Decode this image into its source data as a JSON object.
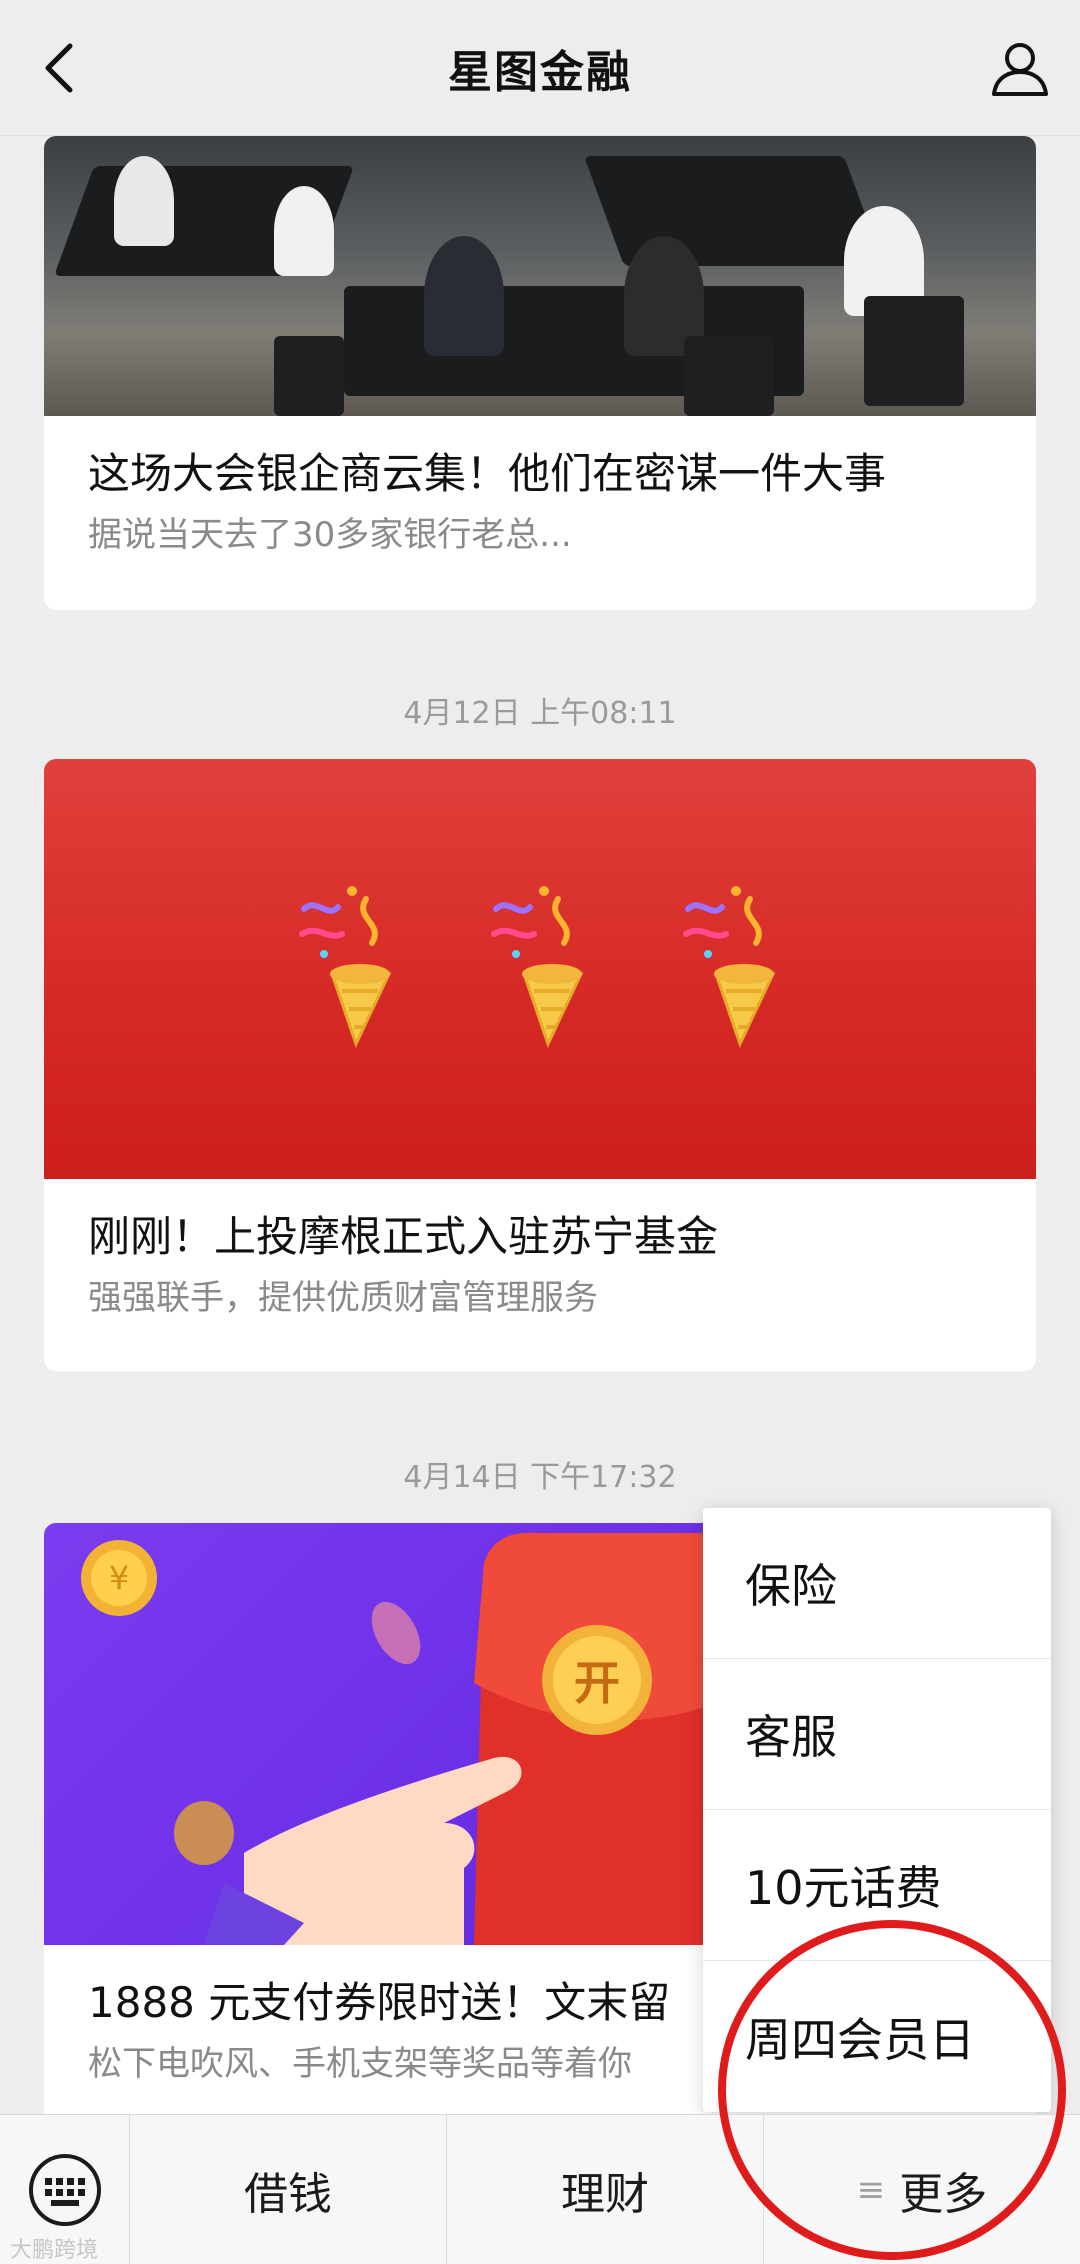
{
  "header": {
    "title": "星图金融",
    "back_icon": "chevron-left-icon",
    "user_icon": "user-icon"
  },
  "articles": [
    {
      "title": "这场大会银企商云集！他们在密谋一件大事",
      "subtitle": "据说当天去了30多家银行老总..."
    },
    {
      "timestamp": "4月12日 上午08:11",
      "title": "刚刚！上投摩根正式入驻苏宁基金",
      "subtitle": "强强联手，提供优质财富管理服务"
    },
    {
      "timestamp": "4月14日 下午17:32",
      "title": "1888 元支付券限时送！文末留",
      "subtitle": "松下电吹风、手机支架等奖品等着你",
      "badge": "开"
    }
  ],
  "bottom_menu": {
    "keyboard_icon": "keyboard-icon",
    "tabs": [
      "借钱",
      "理财",
      "更多"
    ],
    "more_icon": "≡"
  },
  "popup_menu": {
    "items": [
      "保险",
      "客服",
      "10元话费",
      "周四会员日"
    ]
  },
  "watermark": "大鹏跨境",
  "colors": {
    "highlight_circle": "#e01b1b",
    "background": "#ededed"
  }
}
